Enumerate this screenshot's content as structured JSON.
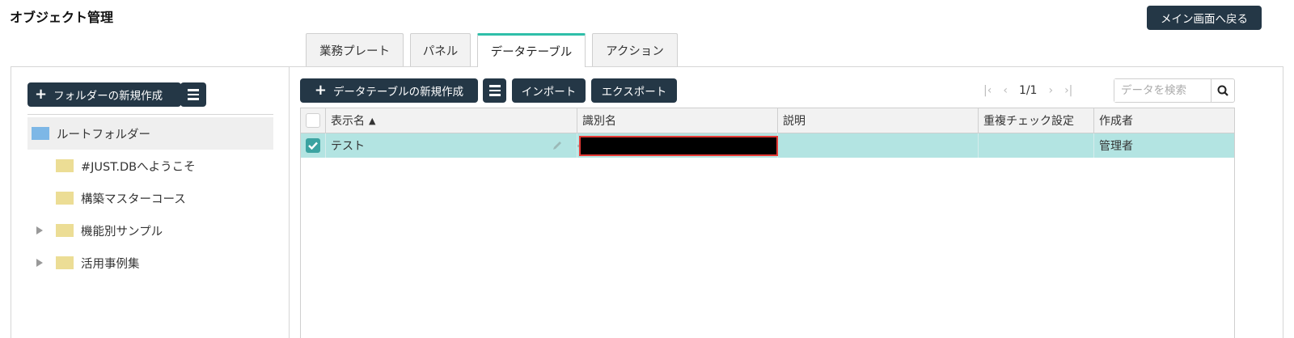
{
  "header": {
    "title": "オブジェクト管理",
    "back_button": "メイン画面へ戻る"
  },
  "tabs": [
    {
      "label": "業務プレート",
      "active": false
    },
    {
      "label": "パネル",
      "active": false
    },
    {
      "label": "データテーブル",
      "active": true
    },
    {
      "label": "アクション",
      "active": false
    }
  ],
  "sidebar": {
    "new_folder_button": "フォルダーの新規作成",
    "tree": [
      {
        "label": "ルートフォルダー",
        "selected": true,
        "icon": "folder-blue-icon"
      },
      {
        "label": "#JUST.DBへようこそ",
        "expandable": false
      },
      {
        "label": "構築マスターコース",
        "expandable": false
      },
      {
        "label": "機能別サンプル",
        "expandable": true
      },
      {
        "label": "活用事例集",
        "expandable": true
      }
    ]
  },
  "toolbar": {
    "new_table_button": "データテーブルの新規作成",
    "import_button": "インポート",
    "export_button": "エクスポート"
  },
  "pager": {
    "page_text": "1/1"
  },
  "search": {
    "placeholder": "データを検索"
  },
  "table": {
    "columns": [
      "表示名",
      "識別名",
      "説明",
      "重複チェック設定",
      "作成者"
    ],
    "sort_indicator": "▲",
    "rows": [
      {
        "display_name": "テスト",
        "identifier": "",
        "description": "",
        "duplicate_check": "",
        "creator": "管理者",
        "checked": true
      }
    ]
  },
  "colors": {
    "dark_button": "#243746",
    "active_tab_accent": "#2fbfa9",
    "selected_row": "#b3e4e2",
    "redaction_border": "#e53935"
  }
}
